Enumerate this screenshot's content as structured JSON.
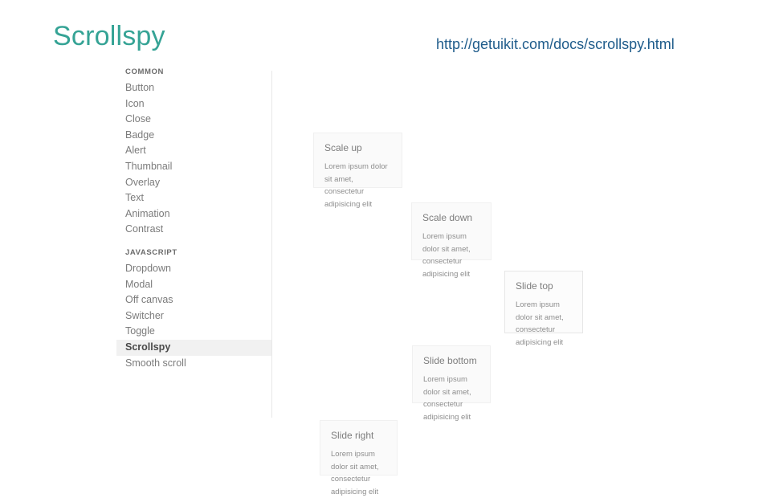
{
  "slide": {
    "title": "Scrollspy",
    "url": "http://getuikit.com/docs/scrollspy.html"
  },
  "docs": {
    "nav": {
      "sections": [
        {
          "title": "COMMON",
          "items": [
            {
              "label": "Button",
              "active": false
            },
            {
              "label": "Icon",
              "active": false
            },
            {
              "label": "Close",
              "active": false
            },
            {
              "label": "Badge",
              "active": false
            },
            {
              "label": "Alert",
              "active": false
            },
            {
              "label": "Thumbnail",
              "active": false
            },
            {
              "label": "Overlay",
              "active": false
            },
            {
              "label": "Text",
              "active": false
            },
            {
              "label": "Animation",
              "active": false
            },
            {
              "label": "Contrast",
              "active": false
            }
          ]
        },
        {
          "title": "JAVASCRIPT",
          "items": [
            {
              "label": "Dropdown",
              "active": false
            },
            {
              "label": "Modal",
              "active": false
            },
            {
              "label": "Off canvas",
              "active": false
            },
            {
              "label": "Switcher",
              "active": false
            },
            {
              "label": "Toggle",
              "active": false
            },
            {
              "label": "Scrollspy",
              "active": true
            },
            {
              "label": "Smooth scroll",
              "active": false
            }
          ]
        }
      ]
    },
    "cards": [
      {
        "id": "card-scale-up",
        "heading": "Scale up",
        "body": "Lorem ipsum dolor sit amet, consectetur adipisicing elit"
      },
      {
        "id": "card-scale-down",
        "heading": "Scale down",
        "body": "Lorem ipsum dolor sit amet, consectetur adipisicing elit"
      },
      {
        "id": "card-slide-top",
        "heading": "Slide top",
        "body": "Lorem ipsum dolor sit amet, consectetur adipisicing elit"
      },
      {
        "id": "card-slide-bottom",
        "heading": "Slide bottom",
        "body": "Lorem ipsum dolor sit amet, consectetur adipisicing elit"
      },
      {
        "id": "card-slide-right",
        "heading": "Slide right",
        "body": "Lorem ipsum dolor sit amet, consectetur adipisicing elit"
      }
    ]
  },
  "colors": {
    "title": "#35a395",
    "url": "#1f5c8b",
    "active_nav_bg": "#f1f1f1",
    "card_bg": "#fafafa"
  }
}
